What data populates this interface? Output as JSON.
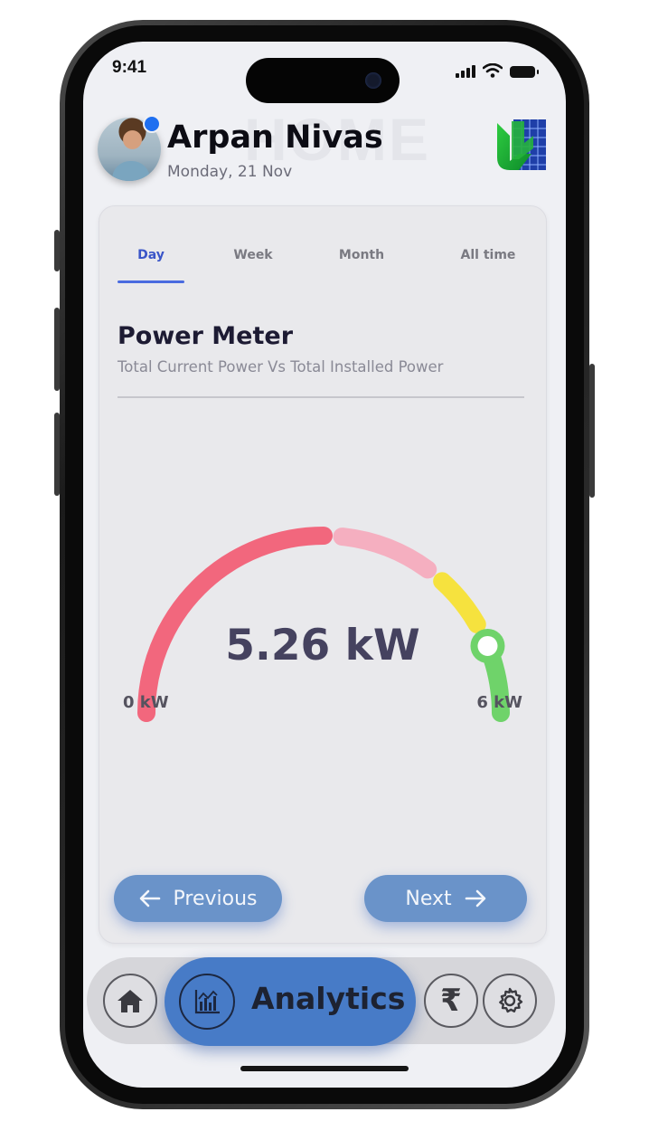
{
  "status_bar": {
    "time": "9:41"
  },
  "header": {
    "user_name": "Arpan Nivas",
    "date": "Monday, 21 Nov",
    "watermark": "HOME",
    "notification_dot_color": "#1f6ff0"
  },
  "tabs": [
    {
      "label": "Day",
      "active": true
    },
    {
      "label": "Week",
      "active": false
    },
    {
      "label": "Month",
      "active": false
    },
    {
      "label": "All time",
      "active": false
    }
  ],
  "power_meter": {
    "title": "Power Meter",
    "subtitle": "Total Current Power Vs Total Installed Power",
    "value_label": "5.26 kW",
    "current_kw": 5.26,
    "min_label": "0 kW",
    "max_label": "6 kW",
    "min_kw": 0,
    "max_kw": 6,
    "segments": [
      {
        "color": "#f2677d",
        "from_kw": 0,
        "to_kw": 3
      },
      {
        "color": "#f5afc0",
        "from_kw": 3.2,
        "to_kw": 4.2
      },
      {
        "color": "#f6e23e",
        "from_kw": 4.4,
        "to_kw": 5.0
      },
      {
        "color": "#6fd36a",
        "from_kw": 5.2,
        "to_kw": 6
      }
    ]
  },
  "navigation": {
    "previous_label": "Previous",
    "next_label": "Next"
  },
  "bottom_nav": {
    "active_label": "Analytics",
    "items": [
      "home-icon",
      "analytics-icon",
      "rupee-icon",
      "gear-icon"
    ],
    "accent_color": "#477bc7"
  }
}
